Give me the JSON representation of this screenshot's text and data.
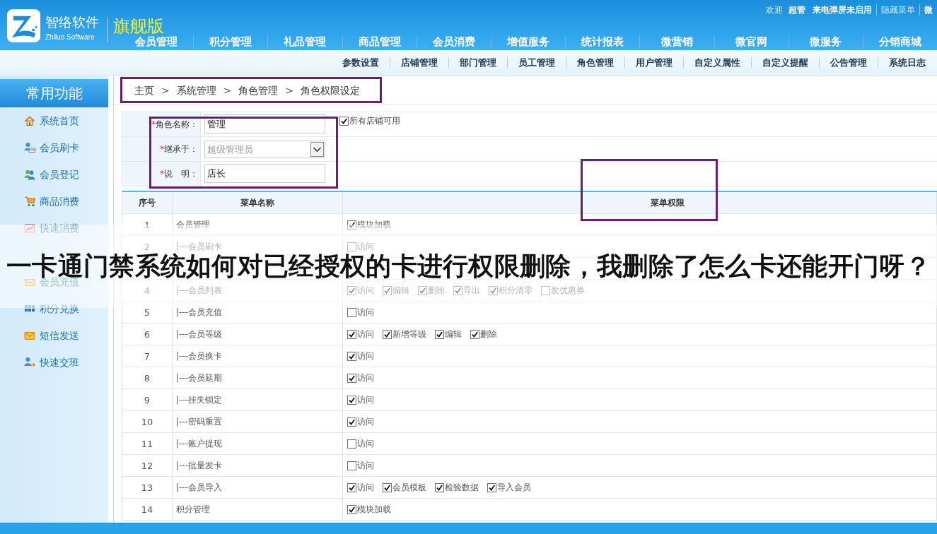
{
  "header": {
    "brand": {
      "name": "智络软件",
      "subtitle": "Zhiluo Software"
    },
    "edition": "旗舰版",
    "user_bar": {
      "greeting": "欢迎",
      "user": "超管",
      "links": [
        {
          "text": "来电弹屏未启用",
          "kind": "strong"
        },
        {
          "text": "隐藏菜单",
          "kind": "muted"
        },
        {
          "text": "微",
          "kind": "strong"
        }
      ]
    },
    "main_nav": [
      "会员管理",
      "积分管理",
      "礼品管理",
      "商品管理",
      "会员消费",
      "增值服务",
      "统计报表",
      "微营销",
      "微官网",
      "微服务",
      "分销商城"
    ]
  },
  "sub_nav": [
    "参数设置",
    "店铺管理",
    "部门管理",
    "员工管理",
    "角色管理",
    "用户管理",
    "自定义属性",
    "自定义提醒",
    "公告管理",
    "系统日志"
  ],
  "sidebar": {
    "title": "常用功能",
    "items": [
      {
        "kind": "link",
        "label": "系统首页"
      },
      {
        "kind": "link",
        "label": "会员刷卡"
      },
      {
        "kind": "link",
        "label": "会员登记"
      },
      {
        "kind": "link",
        "label": "商品消费"
      },
      {
        "kind": "link",
        "label": "快速消费"
      },
      {
        "kind": "covered"
      },
      {
        "kind": "link",
        "label": "会员充值"
      },
      {
        "kind": "link",
        "label": "积分兑换"
      },
      {
        "kind": "link",
        "label": "短信发送"
      },
      {
        "kind": "link",
        "label": "快速交班"
      }
    ]
  },
  "breadcrumb": {
    "items": [
      "主页",
      "系统管理",
      "角色管理",
      "角色权限设定"
    ],
    "separator": ">",
    "highlighted": true
  },
  "role_form": {
    "highlighted": true,
    "rows": [
      {
        "kind": "text",
        "required_mark": "*",
        "label": "角色名称：",
        "value": "管理",
        "disabled": false
      },
      {
        "kind": "select",
        "required_mark": "*",
        "label": "继承于：",
        "value": "超级管理员",
        "disabled": true
      },
      {
        "kind": "text",
        "required_mark": "*",
        "label": "说　明：",
        "value": "店长",
        "disabled": false
      }
    ],
    "all_stores": {
      "label": "所有店铺可用",
      "checked": true
    }
  },
  "permission_table": {
    "columns": [
      {
        "label": "序号",
        "highlighted": false
      },
      {
        "label": "菜单名称",
        "highlighted": false
      },
      {
        "label": "菜单权限",
        "highlighted": true
      }
    ],
    "rows": [
      {
        "kind": "entry",
        "seq": "1",
        "menu": "会员管理",
        "perms": [
          {
            "label": "模块加载",
            "checked": true
          }
        ]
      },
      {
        "kind": "entry",
        "seq": "2",
        "menu": "|---会员刷卡",
        "perms": [
          {
            "label": "访问",
            "checked": false
          }
        ]
      },
      {
        "kind": "covered"
      },
      {
        "kind": "entry",
        "seq": "4",
        "menu": "|---会员列表",
        "perms": [
          {
            "label": "访问",
            "checked": true
          },
          {
            "label": "编辑",
            "checked": true
          },
          {
            "label": "删除",
            "checked": true
          },
          {
            "label": "导出",
            "checked": true
          },
          {
            "label": "积分清零",
            "checked": true
          },
          {
            "label": "发优惠券",
            "checked": false
          }
        ]
      },
      {
        "kind": "entry",
        "seq": "5",
        "menu": "|---会员充值",
        "perms": [
          {
            "label": "访问",
            "checked": false
          }
        ]
      },
      {
        "kind": "entry",
        "seq": "6",
        "menu": "|---会员等级",
        "perms": [
          {
            "label": "访问",
            "checked": true
          },
          {
            "label": "新增等级",
            "checked": true
          },
          {
            "label": "编辑",
            "checked": true
          },
          {
            "label": "删除",
            "checked": true
          }
        ]
      },
      {
        "kind": "entry",
        "seq": "7",
        "menu": "|---会员换卡",
        "perms": [
          {
            "label": "访问",
            "checked": true
          }
        ]
      },
      {
        "kind": "entry",
        "seq": "8",
        "menu": "|---会员延期",
        "perms": [
          {
            "label": "访问",
            "checked": true
          }
        ]
      },
      {
        "kind": "entry",
        "seq": "9",
        "menu": "|---挂失锁定",
        "perms": [
          {
            "label": "访问",
            "checked": true
          }
        ]
      },
      {
        "kind": "entry",
        "seq": "10",
        "menu": "|---密码重置",
        "perms": [
          {
            "label": "访问",
            "checked": true
          }
        ]
      },
      {
        "kind": "entry",
        "seq": "11",
        "menu": "|---账户提现",
        "perms": [
          {
            "label": "访问",
            "checked": false
          }
        ]
      },
      {
        "kind": "entry",
        "seq": "12",
        "menu": "|---批量发卡",
        "perms": [
          {
            "label": "访问",
            "checked": false
          }
        ]
      },
      {
        "kind": "entry",
        "seq": "13",
        "menu": "|---会员导入",
        "perms": [
          {
            "label": "访问",
            "checked": true
          },
          {
            "label": "会员模板",
            "checked": true
          },
          {
            "label": "检验数据",
            "checked": true
          },
          {
            "label": "导入会员",
            "checked": true
          }
        ]
      },
      {
        "kind": "entry",
        "seq": "14",
        "menu": "积分管理",
        "perms": [
          {
            "label": "模块加载",
            "checked": true
          }
        ]
      }
    ]
  },
  "caption": "一卡通门禁系统如何对已经授权的卡进行权限删除，我删除了怎么卡还能开门呀？"
}
